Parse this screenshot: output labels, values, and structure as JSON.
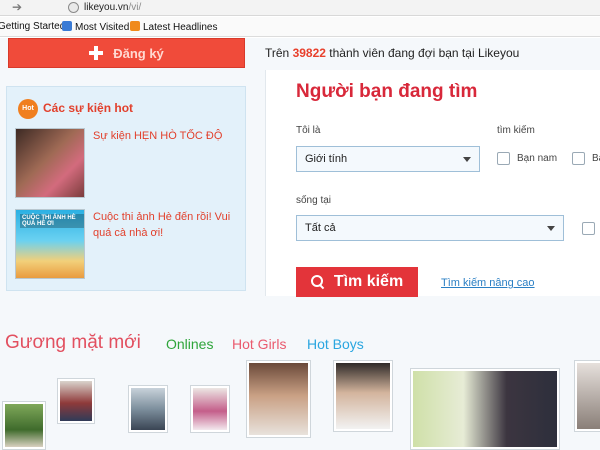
{
  "browser": {
    "url_host": "likeyou.vn",
    "url_path": "/vi/",
    "bookmarks": [
      {
        "label": "Getting Started"
      },
      {
        "label": "Most Visited"
      },
      {
        "label": "Latest Headlines"
      }
    ]
  },
  "header": {
    "register_label": "Đăng ký",
    "members_prefix": "Trên",
    "members_count": "39822",
    "members_suffix": "thành viên đang đợi bạn tại Likeyou"
  },
  "events": {
    "badge": "Hot",
    "title": "Các sự kiện hot",
    "items": [
      {
        "text": "Sự kiện HẸN HÒ TỐC ĐỘ"
      },
      {
        "text": "Cuộc thi ảnh Hè đến rồi! Vui quá cà nhà ơi!",
        "image_caption": "CUỘC THI ẢNH HÈ QUÁ HÈ ƠI"
      }
    ]
  },
  "search": {
    "title": "Người bạn đang tìm",
    "iam_label": "Tôi là",
    "gender_value": "Giới tính",
    "find_label": "tìm kiếm",
    "opt_male": "Bạn nam",
    "opt_female": "Bạ",
    "live_label": "sống tại",
    "location_value": "Tất cả",
    "search_button": "Tìm kiếm",
    "advanced_link": "Tìm kiếm nâng cao"
  },
  "faces": {
    "title": "Gương mặt mới",
    "tabs": [
      "Onlines",
      "Hot Girls",
      "Hot Boys"
    ]
  },
  "colors": {
    "accent_red": "#e3343a",
    "register_red": "#f04b3a",
    "panel_blue": "#e3f1fa",
    "online_green": "#2ea53a",
    "boys_blue": "#2aa6e0"
  }
}
